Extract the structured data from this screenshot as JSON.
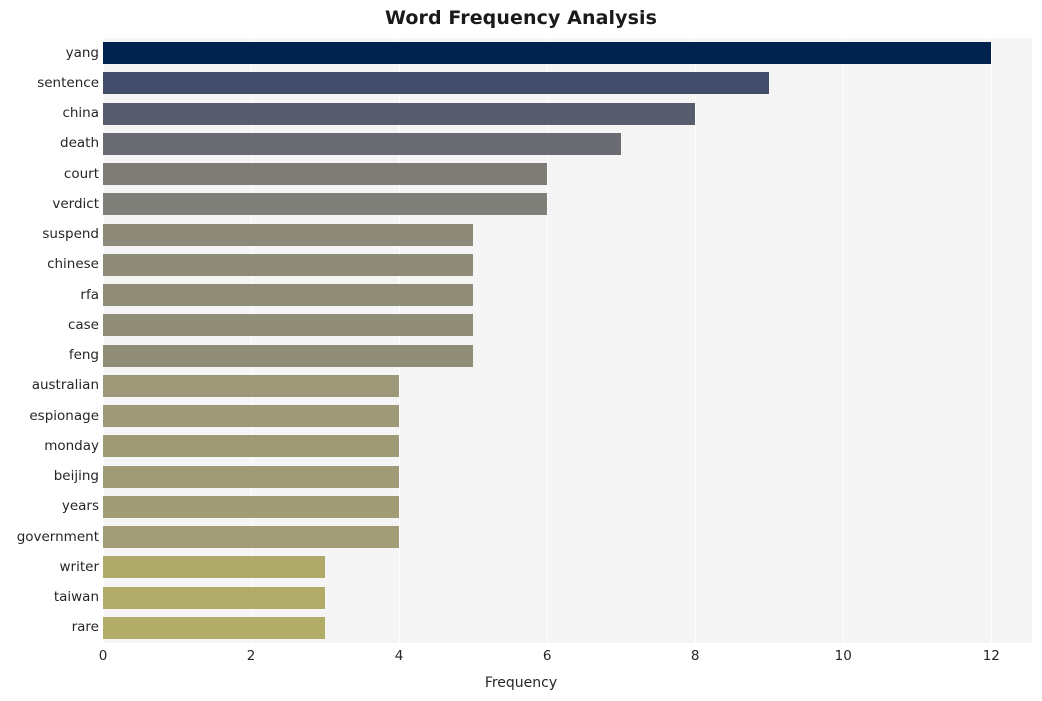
{
  "chart_data": {
    "type": "bar",
    "orientation": "horizontal",
    "title": "Word Frequency Analysis",
    "xlabel": "Frequency",
    "ylabel": "",
    "categories": [
      "yang",
      "sentence",
      "china",
      "death",
      "court",
      "verdict",
      "suspend",
      "chinese",
      "rfa",
      "case",
      "feng",
      "australian",
      "espionage",
      "monday",
      "beijing",
      "years",
      "government",
      "writer",
      "taiwan",
      "rare"
    ],
    "values": [
      12,
      9,
      8,
      7,
      6,
      6,
      5,
      5,
      5,
      5,
      5,
      4,
      4,
      4,
      4,
      4,
      4,
      3,
      3,
      3
    ],
    "bar_colors": [
      "#00224e",
      "#414d6b",
      "#575d6d",
      "#6b6c71",
      "#7f7c75",
      "#80807b",
      "#8c8978",
      "#8e8b78",
      "#8f8c78",
      "#908d78",
      "#918e78",
      "#9d9877",
      "#9e9977",
      "#9f9a76",
      "#a09b76",
      "#a19c76",
      "#a29d76",
      "#b0aa6a",
      "#b1ab6a",
      "#b2ac69"
    ],
    "xticks": [
      0,
      2,
      4,
      6,
      8,
      10,
      12
    ],
    "xlim": [
      0,
      12.55
    ],
    "grid": true,
    "grid_axis": "x",
    "legend": null,
    "plot_background": "#f5f5f5",
    "figure_background": "#ffffff",
    "colormap": "cividis"
  }
}
